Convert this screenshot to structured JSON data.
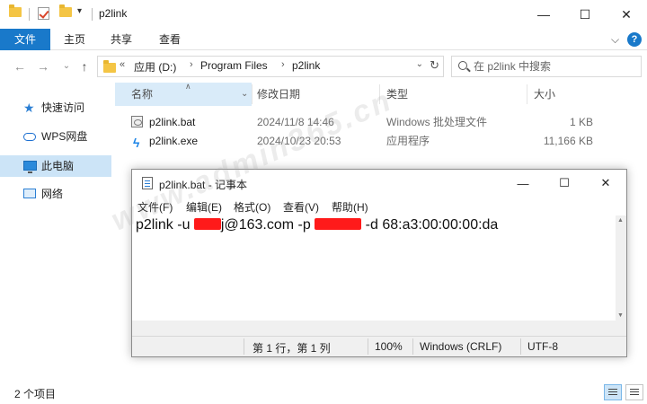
{
  "window": {
    "title": "p2link",
    "minimize_glyph": "—",
    "maximize_glyph": "☐",
    "close_glyph": "✕"
  },
  "ribbon": {
    "tabs": [
      "文件",
      "主页",
      "共享",
      "查看"
    ],
    "expand_glyph": "⌵",
    "help_glyph": "?"
  },
  "nav": {
    "back_glyph": "←",
    "forward_glyph": "→",
    "recent_glyph": "⌄",
    "up_glyph": "↑"
  },
  "address": {
    "overflow": "«",
    "crumbs": [
      "应用 (D:)",
      "Program Files",
      "p2link"
    ],
    "separator": "›",
    "dropdown_glyph": "⌄",
    "refresh_glyph": "↻"
  },
  "search": {
    "placeholder": "在 p2link 中搜索"
  },
  "sidebar": {
    "items": [
      {
        "label": "快速访问",
        "icon": "star-icon"
      },
      {
        "label": "WPS网盘",
        "icon": "cloud-icon"
      },
      {
        "label": "此电脑",
        "icon": "computer-icon",
        "selected": true
      },
      {
        "label": "网络",
        "icon": "network-icon"
      }
    ]
  },
  "filelist": {
    "columns": [
      "名称",
      "修改日期",
      "类型",
      "大小"
    ],
    "sort_arrow": "∧",
    "rows": [
      {
        "name": "p2link.bat",
        "modified": "2024/11/8 14:46",
        "type": "Windows 批处理文件",
        "size": "1 KB",
        "icon": "batch-file-icon"
      },
      {
        "name": "p2link.exe",
        "modified": "2024/10/23 20:53",
        "type": "应用程序",
        "size": "11,166 KB",
        "icon": "exe-file-icon"
      }
    ]
  },
  "notepad": {
    "title": "p2link.bat - 记事本",
    "menus": [
      "文件(F)",
      "编辑(E)",
      "格式(O)",
      "查看(V)",
      "帮助(H)"
    ],
    "content": {
      "prefix": "p2link -u ",
      "after_user": "j@163.com -p ",
      "after_pass": " -d 68:a3:00:00:00:da"
    },
    "status": {
      "position": "第 1 行，第 1 列",
      "zoom": "100%",
      "line_ending": "Windows (CRLF)",
      "encoding": "UTF-8"
    }
  },
  "watermark": "www.admin365.cn",
  "statusbar": {
    "item_count": "2 个项目"
  }
}
